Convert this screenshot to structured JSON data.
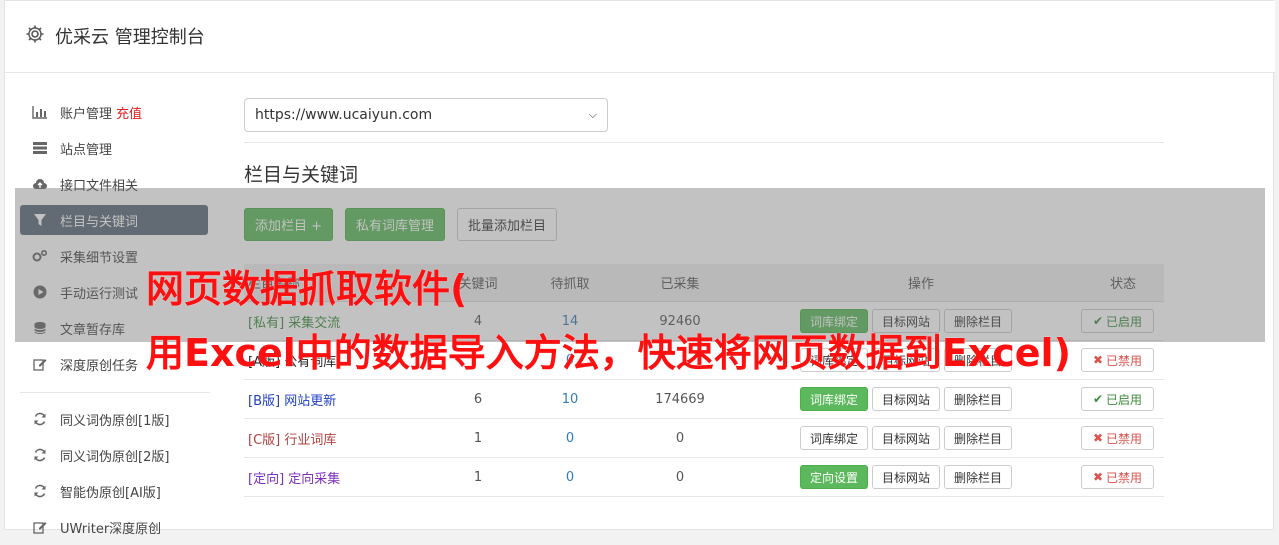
{
  "header": {
    "title": "优采云 管理控制台"
  },
  "sidebar": {
    "items": [
      {
        "label": "账户管理",
        "extra": "充值",
        "icon": "bar-chart-icon"
      },
      {
        "label": "站点管理",
        "icon": "server-icon"
      },
      {
        "label": "接口文件相关",
        "icon": "cloud-upload-icon"
      },
      {
        "label": "栏目与关键词",
        "icon": "filter-icon",
        "active": true
      },
      {
        "label": "采集细节设置",
        "icon": "gears-icon"
      },
      {
        "label": "手动运行测试",
        "icon": "play-circle-icon"
      },
      {
        "label": "文章暂存库",
        "icon": "database-icon"
      },
      {
        "label": "深度原创任务",
        "icon": "edit-icon"
      }
    ],
    "items2": [
      {
        "label": "同义词伪原创[1版]",
        "icon": "refresh-icon"
      },
      {
        "label": "同义词伪原创[2版]",
        "icon": "refresh-icon"
      },
      {
        "label": "智能伪原创[AI版]",
        "icon": "refresh-icon"
      },
      {
        "label": "UWriter深度原创",
        "icon": "edit-icon"
      }
    ]
  },
  "main": {
    "site_select": "https://www.ucaiyun.com",
    "section_title": "栏目与关键词",
    "toolbar": {
      "add_column": "添加栏目 +",
      "private_lexicon": "私有词库管理",
      "batch_add": "批量添加栏目"
    },
    "table": {
      "headers": {
        "name": "栏目名称",
        "n1": "关键词",
        "n2": "待抓取",
        "n3": "已采集",
        "ops": "操作",
        "status": "状态"
      },
      "rows": [
        {
          "tag": "[私有]",
          "name": "采集交流",
          "n1": "4",
          "n2": "14",
          "n3": "92460",
          "op1": "词库绑定",
          "op1_green": true,
          "op2": "目标网站",
          "op3": "删除栏目",
          "status": "已启用",
          "enabled": true,
          "tagclass": "tag-private"
        },
        {
          "tag": "[A版]",
          "name": "公有词库",
          "n1": "",
          "n2": "0",
          "n3": "",
          "op1": "词库绑定",
          "op1_green": false,
          "op2": "目标网站",
          "op3": "删除栏目",
          "status": "已禁用",
          "enabled": false,
          "tagclass": "tag-a"
        },
        {
          "tag": "[B版]",
          "name": "网站更新",
          "n1": "6",
          "n2": "10",
          "n3": "174669",
          "op1": "词库绑定",
          "op1_green": true,
          "op2": "目标网站",
          "op3": "删除栏目",
          "status": "已启用",
          "enabled": true,
          "tagclass": "tag-b"
        },
        {
          "tag": "[C版]",
          "name": "行业词库",
          "n1": "1",
          "n2": "0",
          "n3": "0",
          "op1": "词库绑定",
          "op1_green": false,
          "op2": "目标网站",
          "op3": "删除栏目",
          "status": "已禁用",
          "enabled": false,
          "tagclass": "tag-c"
        },
        {
          "tag": "[定向]",
          "name": "定向采集",
          "n1": "1",
          "n2": "0",
          "n3": "0",
          "op1": "定向设置",
          "op1_green": true,
          "op2": "目标网站",
          "op3": "删除栏目",
          "status": "已禁用",
          "enabled": false,
          "tagclass": "tag-d"
        }
      ]
    }
  },
  "overlay_text": {
    "line1": "网页数据抓取软件(",
    "line2": "用Excel中的数据导入方法，快速将网页数据到Excel)"
  },
  "colors": {
    "accent_green": "#5cb85c",
    "sidebar_active": "#5b6977",
    "overlay_text": "#ff1010"
  }
}
